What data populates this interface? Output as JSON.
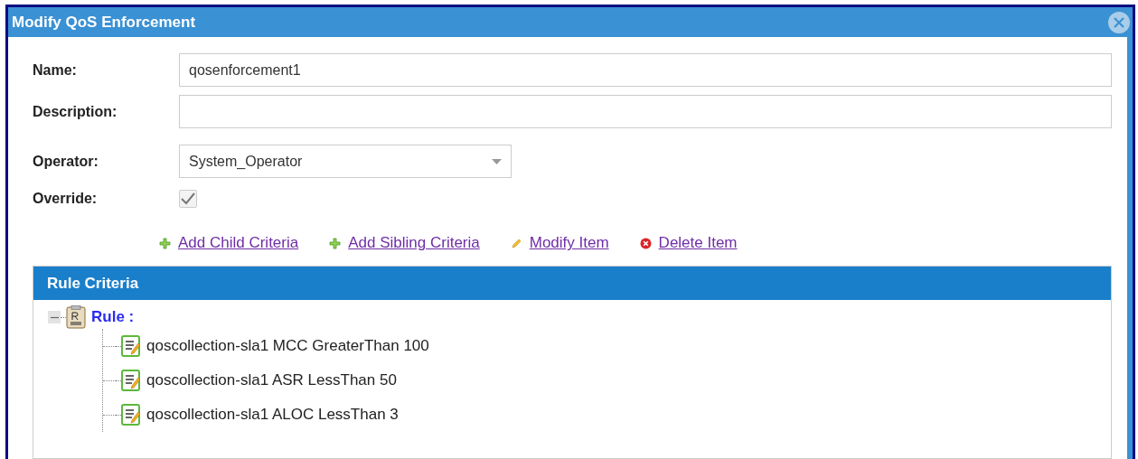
{
  "window": {
    "title": "Modify QoS Enforcement"
  },
  "fields": [
    {
      "kind": "text",
      "label": "Name:",
      "value": "qosenforcement1"
    },
    {
      "kind": "text",
      "label": "Description:"
    },
    {
      "kind": "select",
      "label": "Operator:",
      "value": "System_Operator"
    },
    {
      "kind": "checkbox",
      "label": "Override:",
      "checked": true,
      "disabled": true
    }
  ],
  "actions": [
    {
      "kind": "add",
      "label": "Add Child Criteria"
    },
    {
      "kind": "add",
      "label": "Add Sibling Criteria"
    },
    {
      "kind": "edit",
      "label": "Modify Item"
    },
    {
      "kind": "delete",
      "label": "Delete Item"
    }
  ],
  "rule_criteria": {
    "title": "Rule Criteria",
    "tree": [
      {
        "label": "Rule :",
        "expanded": true,
        "children": [
          {
            "label": "qoscollection-sla1 MCC GreaterThan 100"
          },
          {
            "label": "qoscollection-sla1 ASR LessThan 50"
          },
          {
            "label": "qoscollection-sla1 ALOC LessThan 3"
          }
        ]
      }
    ]
  }
}
